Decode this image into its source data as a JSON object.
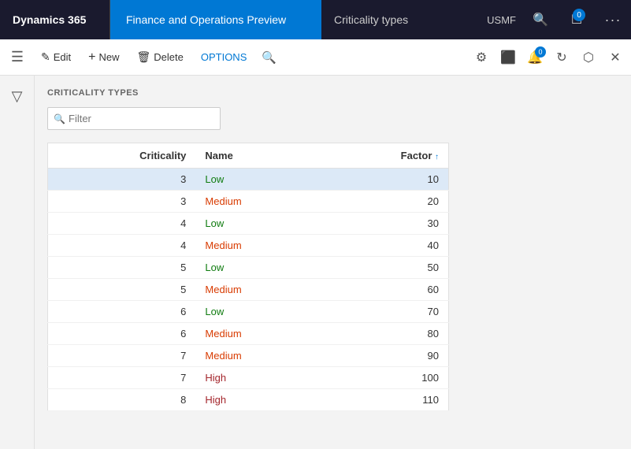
{
  "topNav": {
    "brand": "Dynamics 365",
    "appTitle": "Finance and Operations Preview",
    "pageTitle": "Criticality types",
    "usmf": "USMF",
    "searchIcon": "🔍",
    "notificationIcon": "🔔",
    "badgeCount": "0",
    "moreIcon": "···"
  },
  "toolbar": {
    "hamburgerIcon": "☰",
    "editLabel": "Edit",
    "editIcon": "✎",
    "newLabel": "New",
    "newIcon": "+",
    "deleteLabel": "Delete",
    "deleteIcon": "🗑",
    "optionsLabel": "OPTIONS",
    "searchIcon": "🔍",
    "settingsIcon": "⚙",
    "officeIcon": "⬛",
    "notifIcon": "🔔",
    "refreshIcon": "↻",
    "openInIcon": "⬡",
    "closeIcon": "✕"
  },
  "sidebar": {
    "filterIcon": "▽"
  },
  "content": {
    "sectionTitle": "CRITICALITY TYPES",
    "filterPlaceholder": "Filter"
  },
  "table": {
    "columns": [
      {
        "key": "criticality",
        "label": "Criticality",
        "align": "right"
      },
      {
        "key": "name",
        "label": "Name",
        "align": "left"
      },
      {
        "key": "factor",
        "label": "Factor",
        "align": "right",
        "sorted": true
      }
    ],
    "rows": [
      {
        "criticality": "3",
        "name": "Low",
        "nameType": "low",
        "factor": "10",
        "selected": true
      },
      {
        "criticality": "3",
        "name": "Medium",
        "nameType": "medium",
        "factor": "20",
        "selected": false
      },
      {
        "criticality": "4",
        "name": "Low",
        "nameType": "low",
        "factor": "30",
        "selected": false
      },
      {
        "criticality": "4",
        "name": "Medium",
        "nameType": "medium",
        "factor": "40",
        "selected": false
      },
      {
        "criticality": "5",
        "name": "Low",
        "nameType": "low",
        "factor": "50",
        "selected": false
      },
      {
        "criticality": "5",
        "name": "Medium",
        "nameType": "medium",
        "factor": "60",
        "selected": false
      },
      {
        "criticality": "6",
        "name": "Low",
        "nameType": "low",
        "factor": "70",
        "selected": false
      },
      {
        "criticality": "6",
        "name": "Medium",
        "nameType": "medium",
        "factor": "80",
        "selected": false
      },
      {
        "criticality": "7",
        "name": "Medium",
        "nameType": "medium",
        "factor": "90",
        "selected": false
      },
      {
        "criticality": "7",
        "name": "High",
        "nameType": "high",
        "factor": "100",
        "selected": false
      },
      {
        "criticality": "8",
        "name": "High",
        "nameType": "high",
        "factor": "110",
        "selected": false
      }
    ]
  }
}
